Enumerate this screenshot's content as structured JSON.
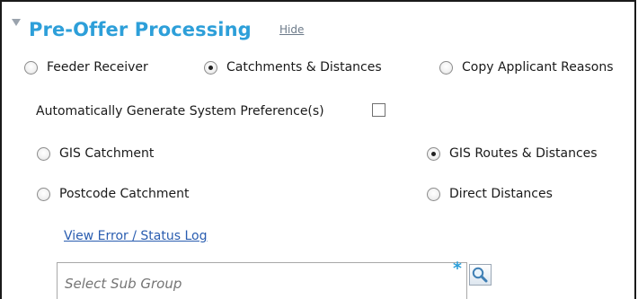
{
  "panel": {
    "title": "Pre-Offer Processing",
    "hide_label": "Hide"
  },
  "mode_options": [
    {
      "label": "Feeder Receiver",
      "selected": false
    },
    {
      "label": "Catchments & Distances",
      "selected": true
    },
    {
      "label": "Copy Applicant Reasons",
      "selected": false
    }
  ],
  "auto_generate": {
    "label": "Automatically Generate System Preference(s)",
    "checked": false
  },
  "catchment_options": [
    {
      "label": "GIS Catchment",
      "selected": false
    },
    {
      "label": "Postcode Catchment",
      "selected": false
    }
  ],
  "distance_options": [
    {
      "label": "GIS Routes & Distances",
      "selected": true
    },
    {
      "label": "Direct Distances",
      "selected": false
    }
  ],
  "status_log_link": "View Error / Status Log",
  "sub_group": {
    "placeholder": "Select Sub Group",
    "value": "",
    "required_marker": "*"
  },
  "icons": {
    "collapse": "triangle-down-icon",
    "lookup": "magnifier-icon"
  },
  "colors": {
    "title": "#2d9fd9",
    "link": "#2a5db0",
    "hide_link": "#6c7a89",
    "required": "#2d9fd9"
  }
}
